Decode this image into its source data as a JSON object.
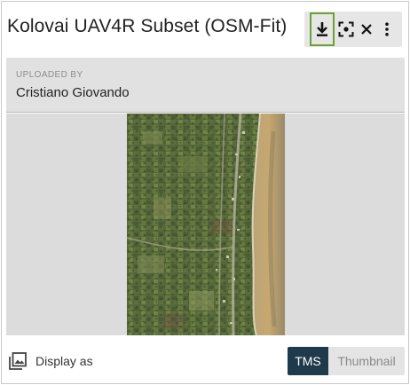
{
  "header": {
    "title": "Kolovai UAV4R Subset (OSM-Fit)",
    "tools": [
      {
        "name": "download-icon"
      },
      {
        "name": "zoom-to-icon"
      },
      {
        "name": "close-icon"
      },
      {
        "name": "more-vertical-icon"
      }
    ]
  },
  "uploader": {
    "label": "UPLOADED BY",
    "name": "Cristiano Giovando"
  },
  "footer": {
    "display_label": "Display as",
    "display_icon": "image-gallery-icon",
    "options": [
      "TMS",
      "Thumbnail"
    ],
    "selected": "TMS"
  },
  "colors": {
    "accent_highlight": "#6aa235",
    "selected_toggle": "#1f3a4a"
  }
}
